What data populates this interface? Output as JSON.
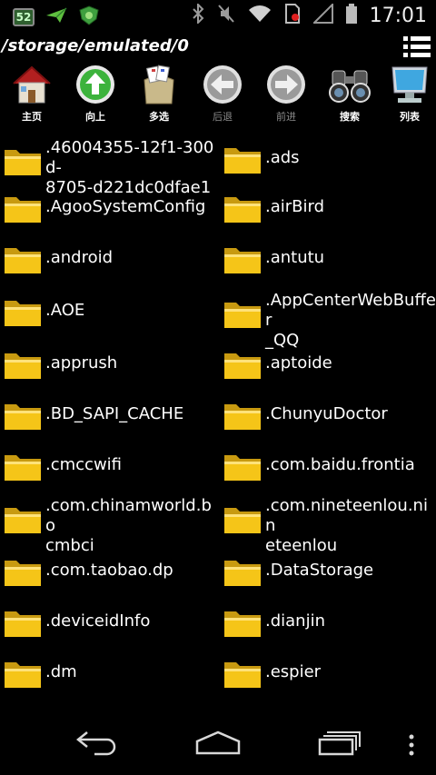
{
  "status_bar": {
    "badge": "52",
    "time": "17:01",
    "icons": [
      "notification-52-icon",
      "send-icon",
      "shield-app-icon",
      "bluetooth-icon",
      "mute-icon",
      "wifi-icon",
      "sim-error-icon",
      "signal-icon",
      "battery-icon"
    ]
  },
  "path": "/storage/emulated/0",
  "toolbar": [
    {
      "label": "主页",
      "icon": "home-icon",
      "enabled": true
    },
    {
      "label": "向上",
      "icon": "up-arrow-icon",
      "enabled": true
    },
    {
      "label": "多选",
      "icon": "multiselect-icon",
      "enabled": true
    },
    {
      "label": "后退",
      "icon": "back-arrow-icon",
      "enabled": false
    },
    {
      "label": "前进",
      "icon": "forward-arrow-icon",
      "enabled": false
    },
    {
      "label": "搜索",
      "icon": "binoculars-icon",
      "enabled": true
    },
    {
      "label": "列表",
      "icon": "monitor-icon",
      "enabled": true
    }
  ],
  "files": [
    {
      "line1": ".46004355-12f1-300d-",
      "line2": "8705-d221dc0dfae1"
    },
    {
      "line1": ".ads",
      "line2": ""
    },
    {
      "line1": ".AgooSystemConfig",
      "line2": ""
    },
    {
      "line1": ".airBird",
      "line2": ""
    },
    {
      "line1": ".android",
      "line2": ""
    },
    {
      "line1": ".antutu",
      "line2": ""
    },
    {
      "line1": ".AOE",
      "line2": ""
    },
    {
      "line1": ".AppCenterWebBuffer",
      "line2": "_QQ"
    },
    {
      "line1": ".apprush",
      "line2": ""
    },
    {
      "line1": ".aptoide",
      "line2": ""
    },
    {
      "line1": ".BD_SAPI_CACHE",
      "line2": ""
    },
    {
      "line1": ".ChunyuDoctor",
      "line2": ""
    },
    {
      "line1": ".cmccwifi",
      "line2": ""
    },
    {
      "line1": ".com.baidu.frontia",
      "line2": ""
    },
    {
      "line1": ".com.chinamworld.bo",
      "line2": "cmbci"
    },
    {
      "line1": ".com.nineteenlou.nin",
      "line2": "eteenlou"
    },
    {
      "line1": ".com.taobao.dp",
      "line2": ""
    },
    {
      "line1": ".DataStorage",
      "line2": ""
    },
    {
      "line1": ".deviceidInfo",
      "line2": ""
    },
    {
      "line1": ".dianjin",
      "line2": ""
    },
    {
      "line1": ".dm",
      "line2": ""
    },
    {
      "line1": ".espier",
      "line2": ""
    }
  ],
  "nav": [
    "back-icon",
    "home-icon",
    "recents-icon",
    "overflow-menu-icon"
  ],
  "colors": {
    "background": "#000000",
    "folder": "#f5c518",
    "folder_dark": "#c89a10"
  }
}
